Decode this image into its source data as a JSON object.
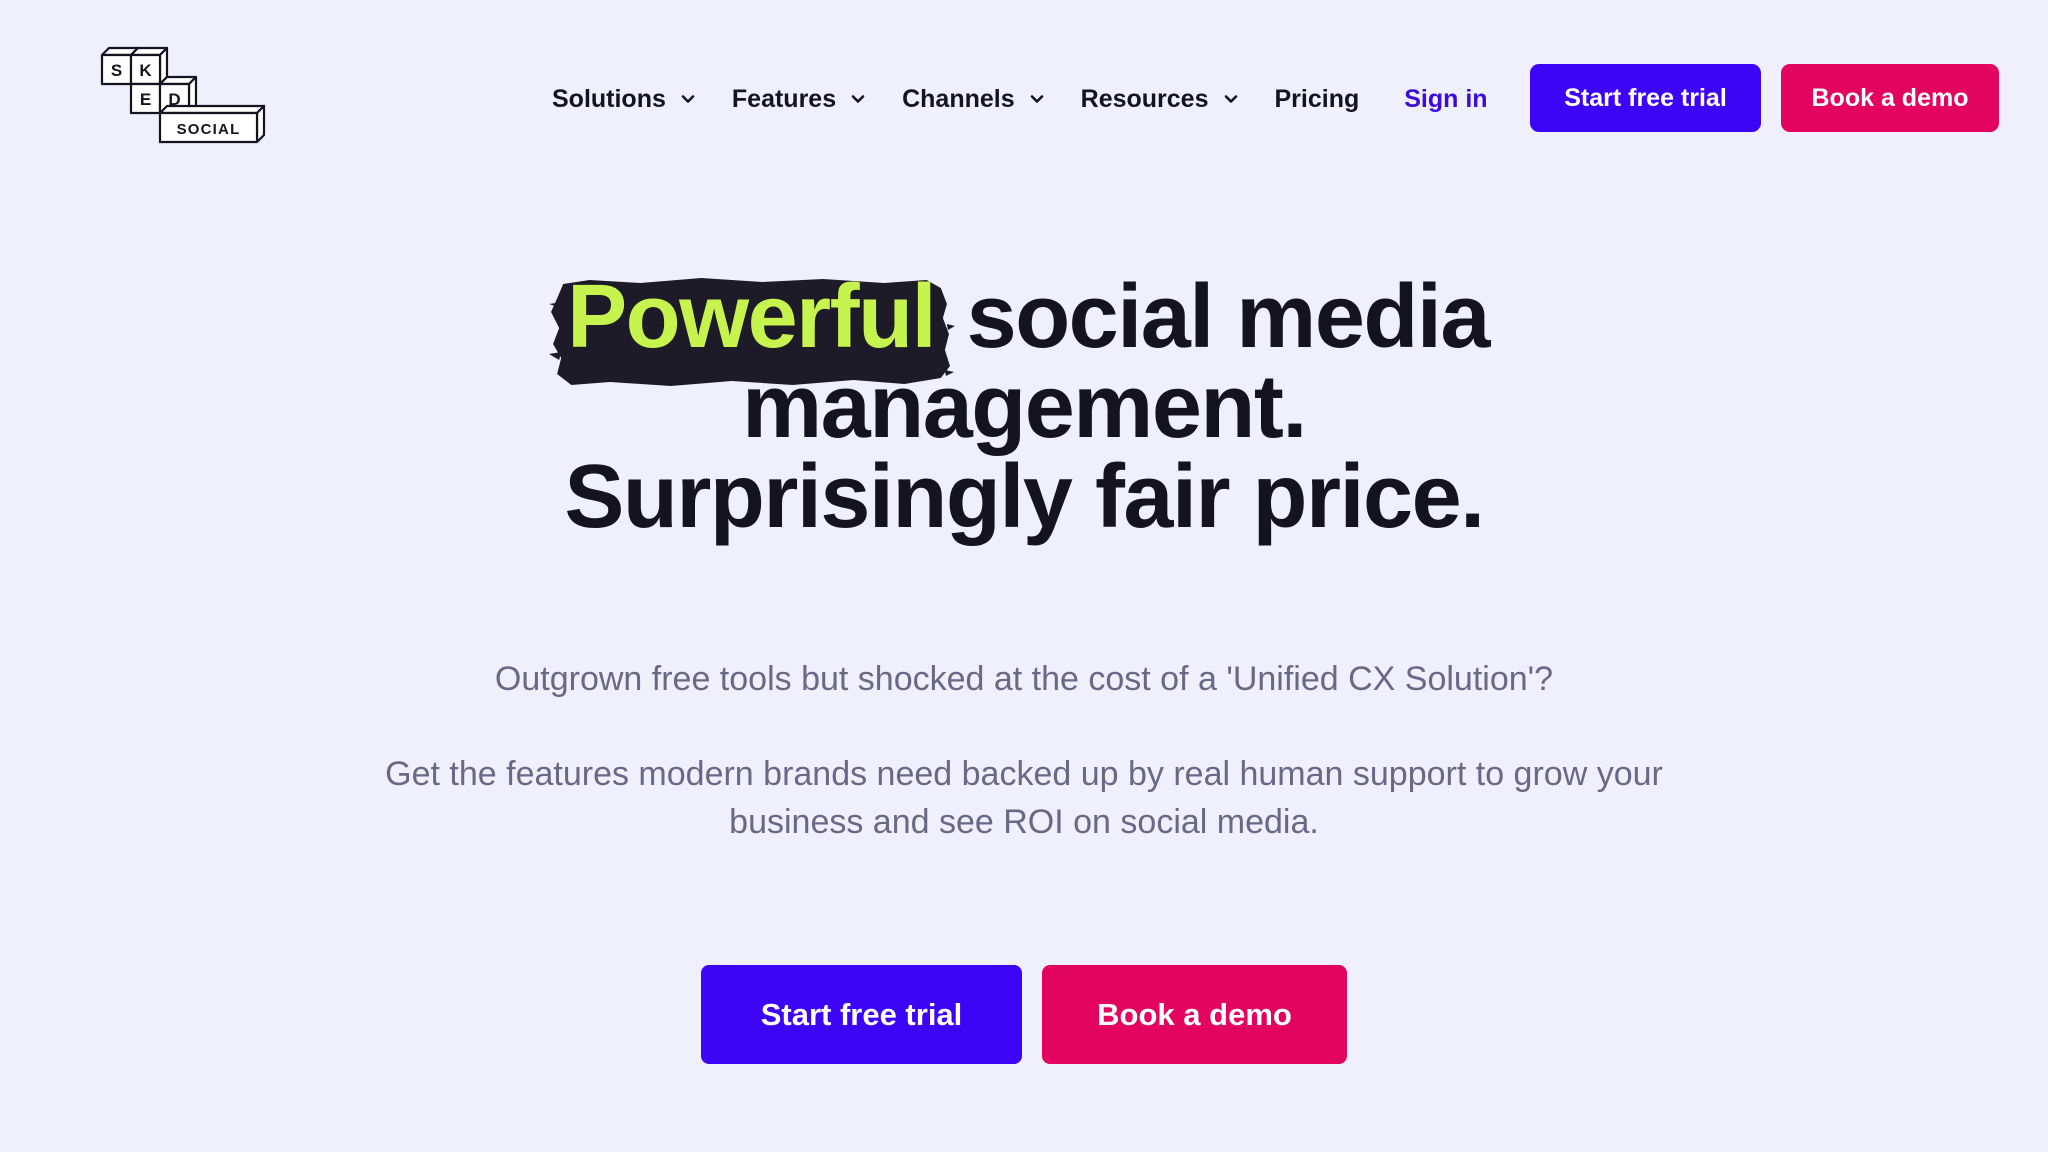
{
  "header": {
    "logo": {
      "letters": [
        "S",
        "K",
        "E",
        "D",
        "SOCIAL"
      ]
    },
    "nav": [
      {
        "label": "Solutions",
        "has_dropdown": true
      },
      {
        "label": "Features",
        "has_dropdown": true
      },
      {
        "label": "Channels",
        "has_dropdown": true
      },
      {
        "label": "Resources",
        "has_dropdown": true
      },
      {
        "label": "Pricing",
        "has_dropdown": false
      }
    ],
    "sign_in_label": "Sign in",
    "trial_label": "Start free trial",
    "demo_label": "Book a demo"
  },
  "hero": {
    "headline_highlight": "Powerful",
    "headline_rest": "social media",
    "headline_line2": "management.",
    "headline_line3": "Surprisingly fair price.",
    "subtext_1": "Outgrown free tools but shocked at the cost of a 'Unified CX Solution'?",
    "subtext_2": "Get the features modern brands need backed up by real human support to grow your business and see ROI on social media.",
    "trial_label": "Start free trial",
    "demo_label": "Book a demo"
  },
  "colors": {
    "background": "#f0effc",
    "primary": "#3d05f5",
    "accent": "#e2045f",
    "highlight_text": "#c6f34d",
    "text_dark": "#15131f",
    "text_muted": "#6a6887"
  }
}
